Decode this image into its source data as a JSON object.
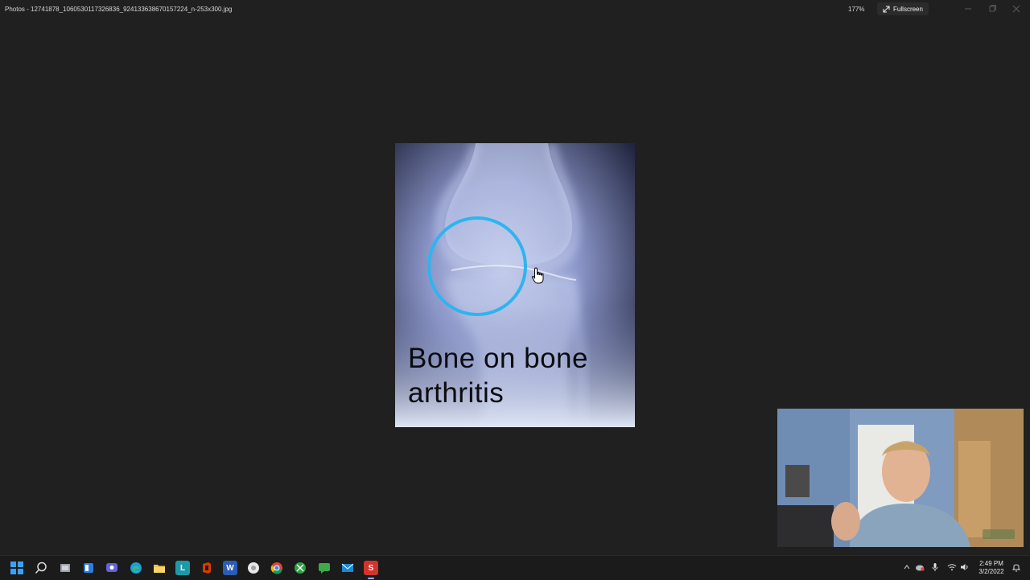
{
  "window": {
    "title": "Photos - 12741878_1060530117326836_9241336386701572​24_n-253x300.jpg",
    "zoom": "177%",
    "fullscreen_label": "Fullscreen"
  },
  "photo": {
    "caption_line1": "Bone  on  bone",
    "caption_line2": "arthritis"
  },
  "taskbar": {
    "icons": [
      "start-icon",
      "search-icon",
      "task-view-icon",
      "widgets-icon",
      "teams-chat-icon",
      "edge-icon",
      "file-explorer-icon",
      "app-l-icon",
      "office-icon",
      "word-icon",
      "chrome-canary-icon",
      "chrome-icon",
      "xbox-icon",
      "messaging-icon",
      "mail-icon",
      "snagit-icon"
    ],
    "time": "2:49 PM",
    "date": "3/2/2022"
  },
  "colors": {
    "background": "#202020",
    "taskbar": "#1b1b1b",
    "circle": "#2fb4ef",
    "accent": "#88b8ff"
  }
}
